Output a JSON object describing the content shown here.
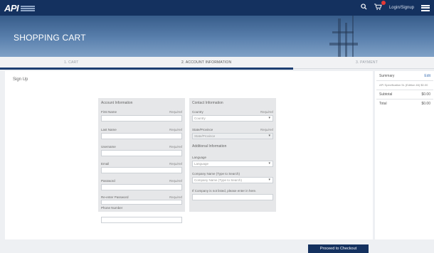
{
  "nav": {
    "logo": "API",
    "login": "Login/Signup"
  },
  "hero": {
    "title": "SHOPPING CART"
  },
  "steps": [
    {
      "label": "1. CART"
    },
    {
      "label": "2. ACCOUNT INFORMATION"
    },
    {
      "label": "3. PAYMENT"
    }
  ],
  "signup": {
    "title": "Sign Up"
  },
  "account": {
    "title": "Account Information",
    "required_label": "Required",
    "fields": [
      {
        "label": "First Name"
      },
      {
        "label": "Last Name"
      },
      {
        "label": "Username"
      },
      {
        "label": "Email"
      },
      {
        "label": "Password"
      },
      {
        "label": "Re-enter Password"
      },
      {
        "label": "Phone Number"
      }
    ]
  },
  "contact": {
    "title": "Contact Information",
    "country_label": "Country",
    "country_req": "Required",
    "country_value": "Country",
    "state_label": "State/Province",
    "state_req": "Required",
    "state_value": "State/Province",
    "additional_title": "Additional Information",
    "language_label": "Language",
    "language_value": "Language",
    "company_label": "Company Name (Type to Search)",
    "company_value": "Company Name (Type to Search)",
    "company_not_listed": "If Company is not listed, please enter in here."
  },
  "checkout": {
    "proceed_label": "Proceed to Checkout"
  },
  "summary": {
    "title": "Summary",
    "edit": "Edit",
    "item": "API Specification 5L (Edition 46) $0.00",
    "subtotal_label": "Subtotal",
    "subtotal_value": "$0.00",
    "total_label": "Total",
    "total_value": "$0.00"
  }
}
